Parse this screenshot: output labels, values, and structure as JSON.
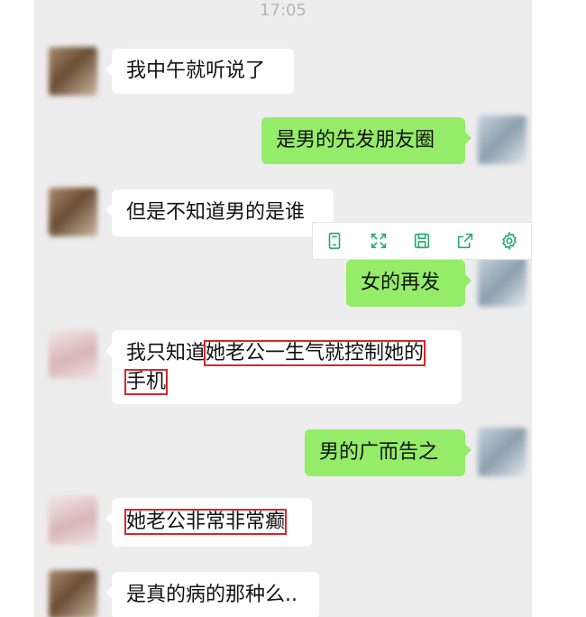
{
  "chat": {
    "time": "17:05",
    "messages": [
      {
        "side": "in",
        "text": "我中午就听说了"
      },
      {
        "side": "out",
        "text": "是男的先发朋友圈"
      },
      {
        "side": "in",
        "text": "但是不知道男的是谁"
      },
      {
        "side": "out",
        "text": "女的再发"
      },
      {
        "side": "in",
        "text_a": "我只知道",
        "text_b": "她老公一生气就控制她的",
        "text_c": "手机"
      },
      {
        "side": "out",
        "text": "男的广而告之"
      },
      {
        "side": "in",
        "text": "她老公非常非常癫"
      },
      {
        "side": "in",
        "text": "是真的病的那种么.."
      }
    ]
  },
  "toolbar": {
    "icons": [
      "tablet-icon",
      "fullscreen-icon",
      "save-icon",
      "share-icon",
      "settings-gear-icon"
    ],
    "accent_color": "#2bab6f"
  },
  "colors": {
    "chat_bg": "#ededed",
    "incoming_bubble": "#ffffff",
    "outgoing_bubble": "#95ec69",
    "highlight_box": "#d8262d"
  }
}
